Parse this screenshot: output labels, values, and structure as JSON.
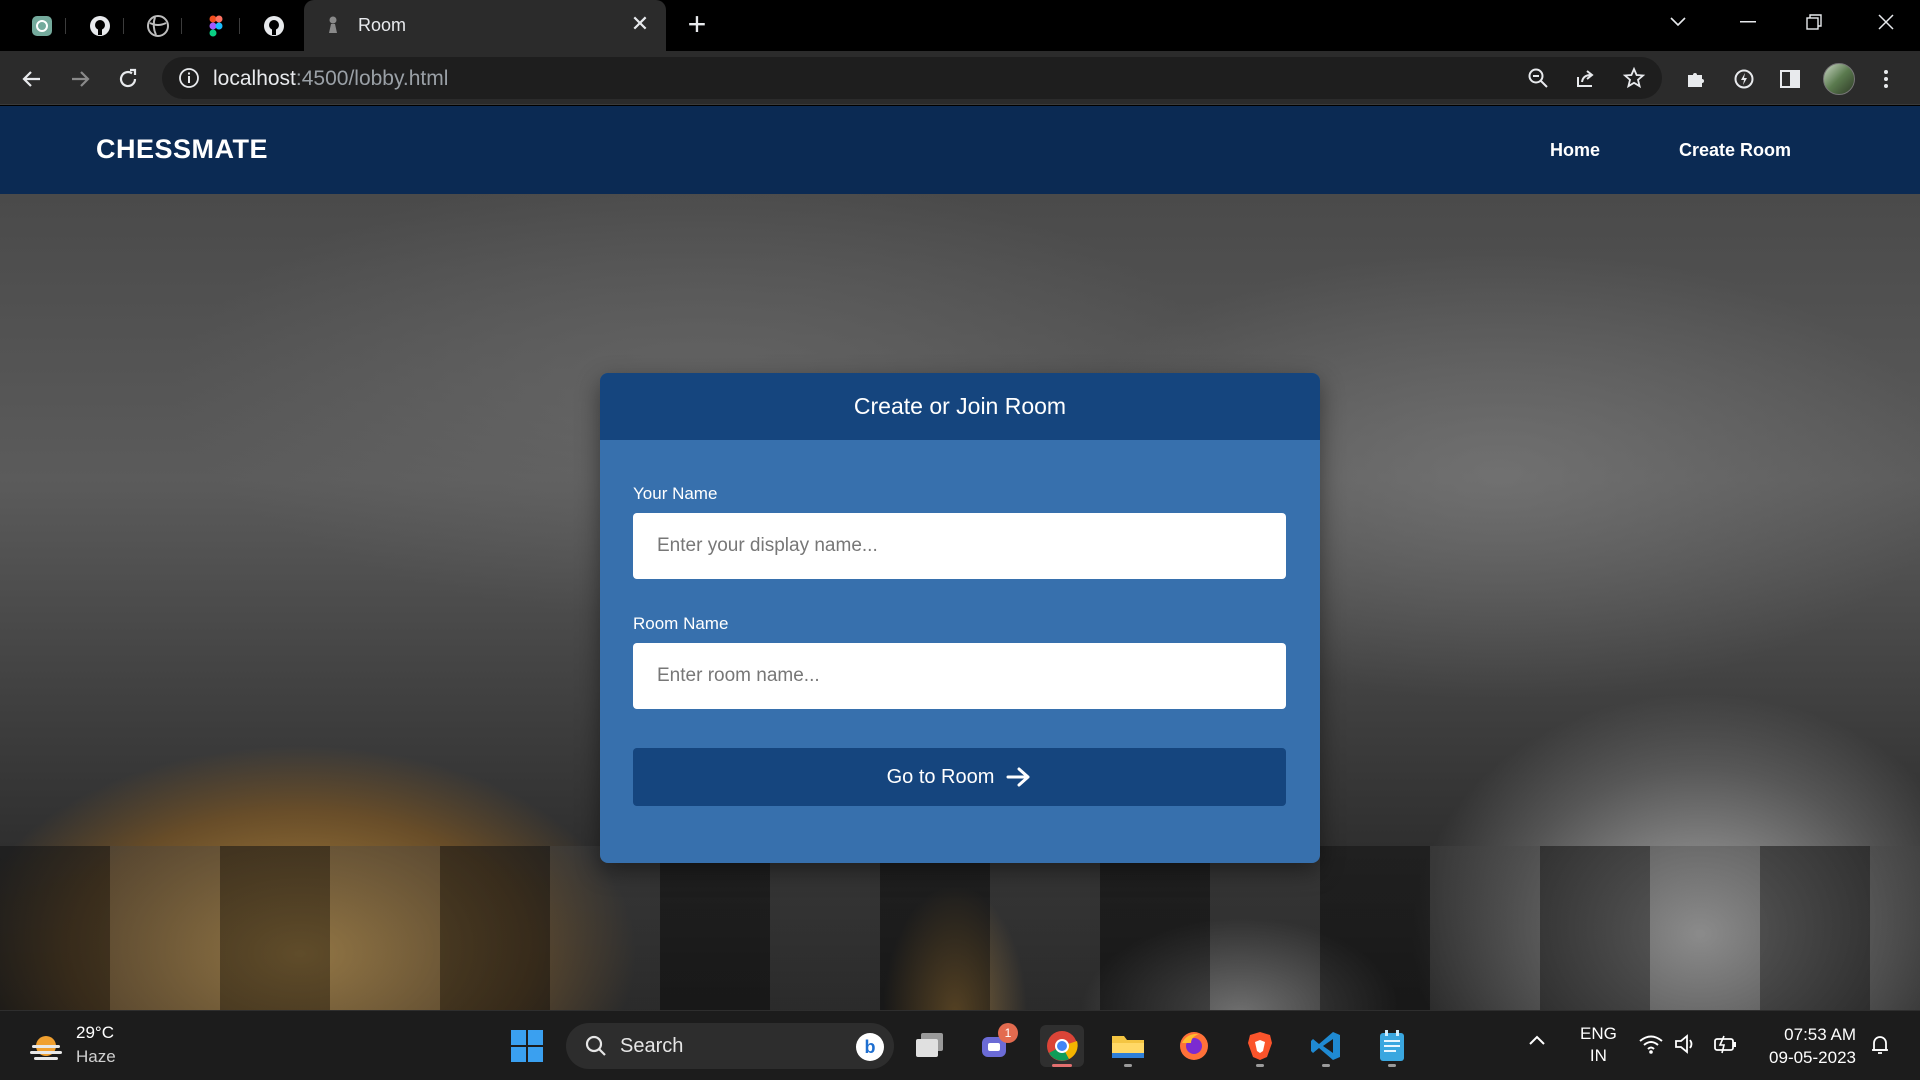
{
  "browser": {
    "active_tab_title": "Room",
    "url_host": "localhost",
    "url_rest": ":4500/lobby.html",
    "pinned_tabs": [
      "chatgpt-icon",
      "github-icon",
      "globe-icon",
      "figma-icon",
      "github-icon"
    ]
  },
  "site": {
    "brand": "CHESSMATE",
    "nav": {
      "home": "Home",
      "create_room": "Create Room"
    }
  },
  "form": {
    "title": "Create or Join Room",
    "name_label": "Your Name",
    "name_placeholder": "Enter your display name...",
    "room_label": "Room Name",
    "room_placeholder": "Enter room name...",
    "submit_label": "Go to Room",
    "submit_icon": "arrow-right-icon"
  },
  "colors": {
    "navbar": "#0b2a53",
    "card": "#3770ad",
    "card_header": "#15457e",
    "button": "#15457e"
  },
  "taskbar": {
    "weather_temp": "29°C",
    "weather_cond": "Haze",
    "search_label": "Search",
    "chat_badge": "1",
    "lang_line1": "ENG",
    "lang_line2": "IN",
    "time": "07:53 AM",
    "date": "09-05-2023"
  }
}
